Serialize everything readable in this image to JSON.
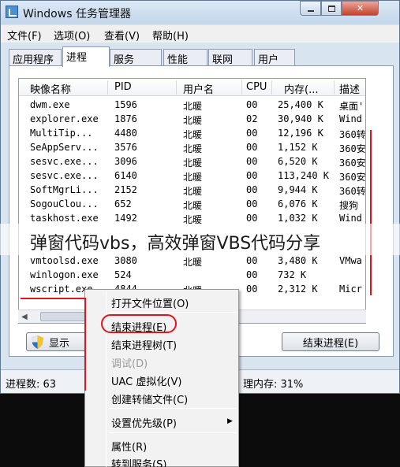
{
  "window": {
    "title": "Windows 任务管理器",
    "controls": {
      "minimize": "min",
      "maximize": "max",
      "close": "✕"
    }
  },
  "menubar": [
    "文件(F)",
    "选项(O)",
    "查看(V)",
    "帮助(H)"
  ],
  "tabs": [
    "应用程序",
    "进程",
    "服务",
    "性能",
    "联网",
    "用户"
  ],
  "active_tab": "进程",
  "columns": [
    "映像名称",
    "PID",
    "用户名",
    "CPU",
    "内存(...",
    "描述"
  ],
  "rows": [
    [
      "dwm.exe",
      "1596",
      "北暖",
      "00",
      "25,400 K",
      "桌面'"
    ],
    [
      "explorer.exe",
      "1876",
      "北暖",
      "02",
      "30,940 K",
      "Wind"
    ],
    [
      "MultiTip...",
      "4480",
      "北暖",
      "00",
      "12,196 K",
      "360转"
    ],
    [
      "SeAppServ...",
      "3576",
      "北暖",
      "00",
      "1,152 K",
      "360安"
    ],
    [
      "sesvc.exe...",
      "3096",
      "北暖",
      "00",
      "6,520 K",
      "360安"
    ],
    [
      "sesvc.exe...",
      "6140",
      "北暖",
      "00",
      "113,240 K",
      "360安"
    ],
    [
      "SoftMgrLi...",
      "2152",
      "北暖",
      "00",
      "9,944 K",
      "360转"
    ],
    [
      "SogouClou...",
      "652",
      "北暖",
      "00",
      "6,076 K",
      "搜狗"
    ],
    [
      "taskhost.exe",
      "1492",
      "北暖",
      "00",
      "1,032 K",
      "Wind"
    ],
    [
      "",
      "",
      "",
      "",
      "",
      ""
    ],
    [
      "vmtoolsd.exe",
      "3080",
      "北暖",
      "00",
      "3,480 K",
      "VMwa"
    ],
    [
      "winlogon.exe",
      "524",
      "",
      "00",
      "732 K",
      ""
    ],
    [
      "wscript.exe",
      "4844",
      "北暖",
      "00",
      "2,312 K",
      "Micr"
    ]
  ],
  "buttons": {
    "show_all": "显示",
    "end_process": "结束进程(E)"
  },
  "status": {
    "process_count": "进程数: 63",
    "physical_memory": "理内存: 31%"
  },
  "context_menu": {
    "items": [
      {
        "label": "打开文件位置(O)",
        "disabled": false
      },
      {
        "label": "结束进程(E)",
        "disabled": false
      },
      {
        "label": "结束进程树(T)",
        "disabled": false
      },
      {
        "label": "调试(D)",
        "disabled": true
      },
      {
        "label": "UAC 虚拟化(V)",
        "disabled": false
      },
      {
        "label": "创建转储文件(C)",
        "disabled": false
      },
      {
        "label": "设置优先级(P)",
        "disabled": false
      },
      {
        "label": "属性(R)",
        "disabled": false
      },
      {
        "label": "转到服务(S)",
        "disabled": false
      }
    ]
  },
  "watermark": "弹窗代码vbs，高效弹窗VBS代码分享",
  "colors": {
    "annotation_red": "#e0141e",
    "title_bar": "#c4d6ea",
    "close_button": "#c6402b"
  }
}
